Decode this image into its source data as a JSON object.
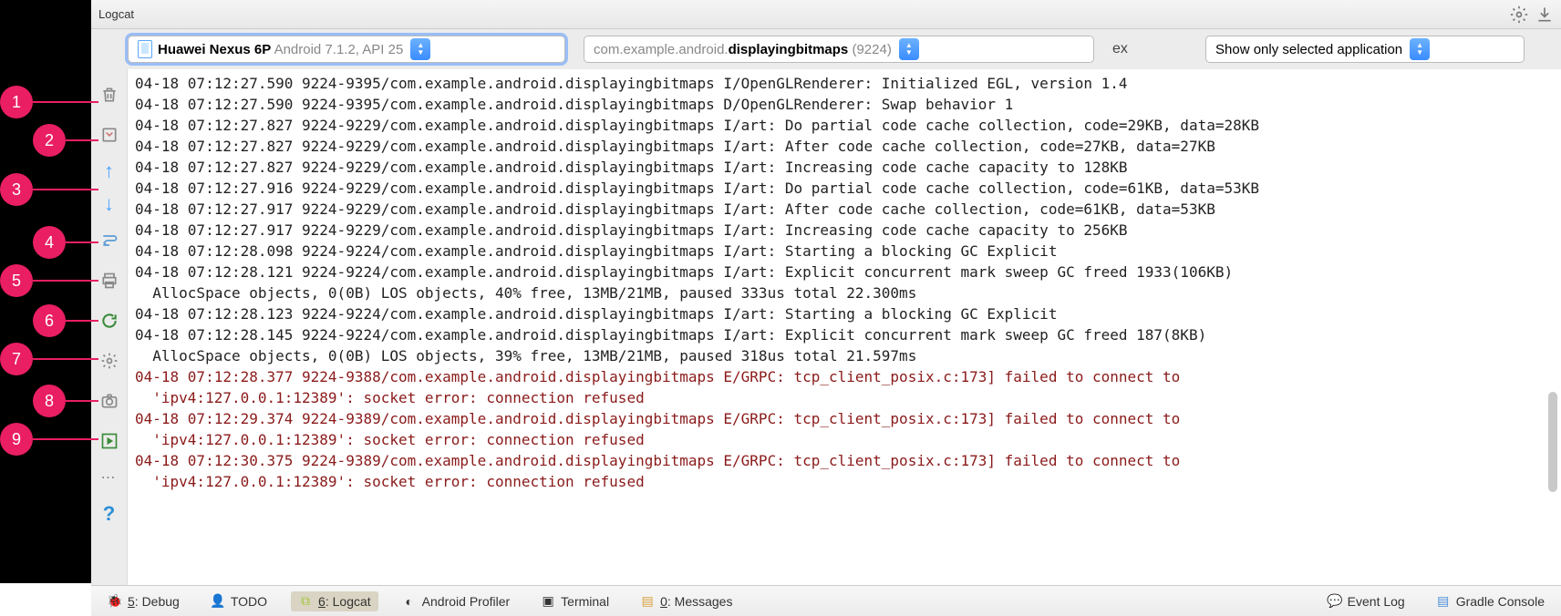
{
  "header": {
    "title": "Logcat"
  },
  "filters": {
    "device": {
      "name": "Huawei Nexus 6P",
      "os": "Android 7.1.2, API 25"
    },
    "process": {
      "prefix": "com.example.android.",
      "bold": "displayingbitmaps",
      "pid": " (9224)"
    },
    "regex_fragment": "ex",
    "scope": "Show only selected application"
  },
  "log_lines": [
    {
      "level": "I",
      "text": "04-18 07:12:27.590 9224-9395/com.example.android.displayingbitmaps I/OpenGLRenderer: Initialized EGL, version 1.4"
    },
    {
      "level": "D",
      "text": "04-18 07:12:27.590 9224-9395/com.example.android.displayingbitmaps D/OpenGLRenderer: Swap behavior 1"
    },
    {
      "level": "I",
      "text": "04-18 07:12:27.827 9224-9229/com.example.android.displayingbitmaps I/art: Do partial code cache collection, code=29KB, data=28KB"
    },
    {
      "level": "I",
      "text": "04-18 07:12:27.827 9224-9229/com.example.android.displayingbitmaps I/art: After code cache collection, code=27KB, data=27KB"
    },
    {
      "level": "I",
      "text": "04-18 07:12:27.827 9224-9229/com.example.android.displayingbitmaps I/art: Increasing code cache capacity to 128KB"
    },
    {
      "level": "I",
      "text": "04-18 07:12:27.916 9224-9229/com.example.android.displayingbitmaps I/art: Do partial code cache collection, code=61KB, data=53KB"
    },
    {
      "level": "I",
      "text": "04-18 07:12:27.917 9224-9229/com.example.android.displayingbitmaps I/art: After code cache collection, code=61KB, data=53KB"
    },
    {
      "level": "I",
      "text": "04-18 07:12:27.917 9224-9229/com.example.android.displayingbitmaps I/art: Increasing code cache capacity to 256KB"
    },
    {
      "level": "I",
      "text": "04-18 07:12:28.098 9224-9224/com.example.android.displayingbitmaps I/art: Starting a blocking GC Explicit"
    },
    {
      "level": "I",
      "text": "04-18 07:12:28.121 9224-9224/com.example.android.displayingbitmaps I/art: Explicit concurrent mark sweep GC freed 1933(106KB)"
    },
    {
      "level": "I",
      "text": "  AllocSpace objects, 0(0B) LOS objects, 40% free, 13MB/21MB, paused 333us total 22.300ms"
    },
    {
      "level": "I",
      "text": "04-18 07:12:28.123 9224-9224/com.example.android.displayingbitmaps I/art: Starting a blocking GC Explicit"
    },
    {
      "level": "I",
      "text": "04-18 07:12:28.145 9224-9224/com.example.android.displayingbitmaps I/art: Explicit concurrent mark sweep GC freed 187(8KB)"
    },
    {
      "level": "I",
      "text": "  AllocSpace objects, 0(0B) LOS objects, 39% free, 13MB/21MB, paused 318us total 21.597ms"
    },
    {
      "level": "E",
      "text": "04-18 07:12:28.377 9224-9388/com.example.android.displayingbitmaps E/GRPC: tcp_client_posix.c:173] failed to connect to"
    },
    {
      "level": "E",
      "text": "  'ipv4:127.0.0.1:12389': socket error: connection refused"
    },
    {
      "level": "E",
      "text": "04-18 07:12:29.374 9224-9389/com.example.android.displayingbitmaps E/GRPC: tcp_client_posix.c:173] failed to connect to"
    },
    {
      "level": "E",
      "text": "  'ipv4:127.0.0.1:12389': socket error: connection refused"
    },
    {
      "level": "E",
      "text": "04-18 07:12:30.375 9224-9389/com.example.android.displayingbitmaps E/GRPC: tcp_client_posix.c:173] failed to connect to"
    },
    {
      "level": "E",
      "text": "  'ipv4:127.0.0.1:12389': socket error: connection refused"
    }
  ],
  "callouts": [
    "1",
    "2",
    "3",
    "4",
    "5",
    "6",
    "7",
    "8",
    "9"
  ],
  "status": {
    "debug": "5: Debug",
    "todo": "TODO",
    "logcat": "6: Logcat",
    "profiler": "Android Profiler",
    "terminal": "Terminal",
    "messages": "0: Messages",
    "eventlog": "Event Log",
    "gradle": "Gradle Console"
  }
}
